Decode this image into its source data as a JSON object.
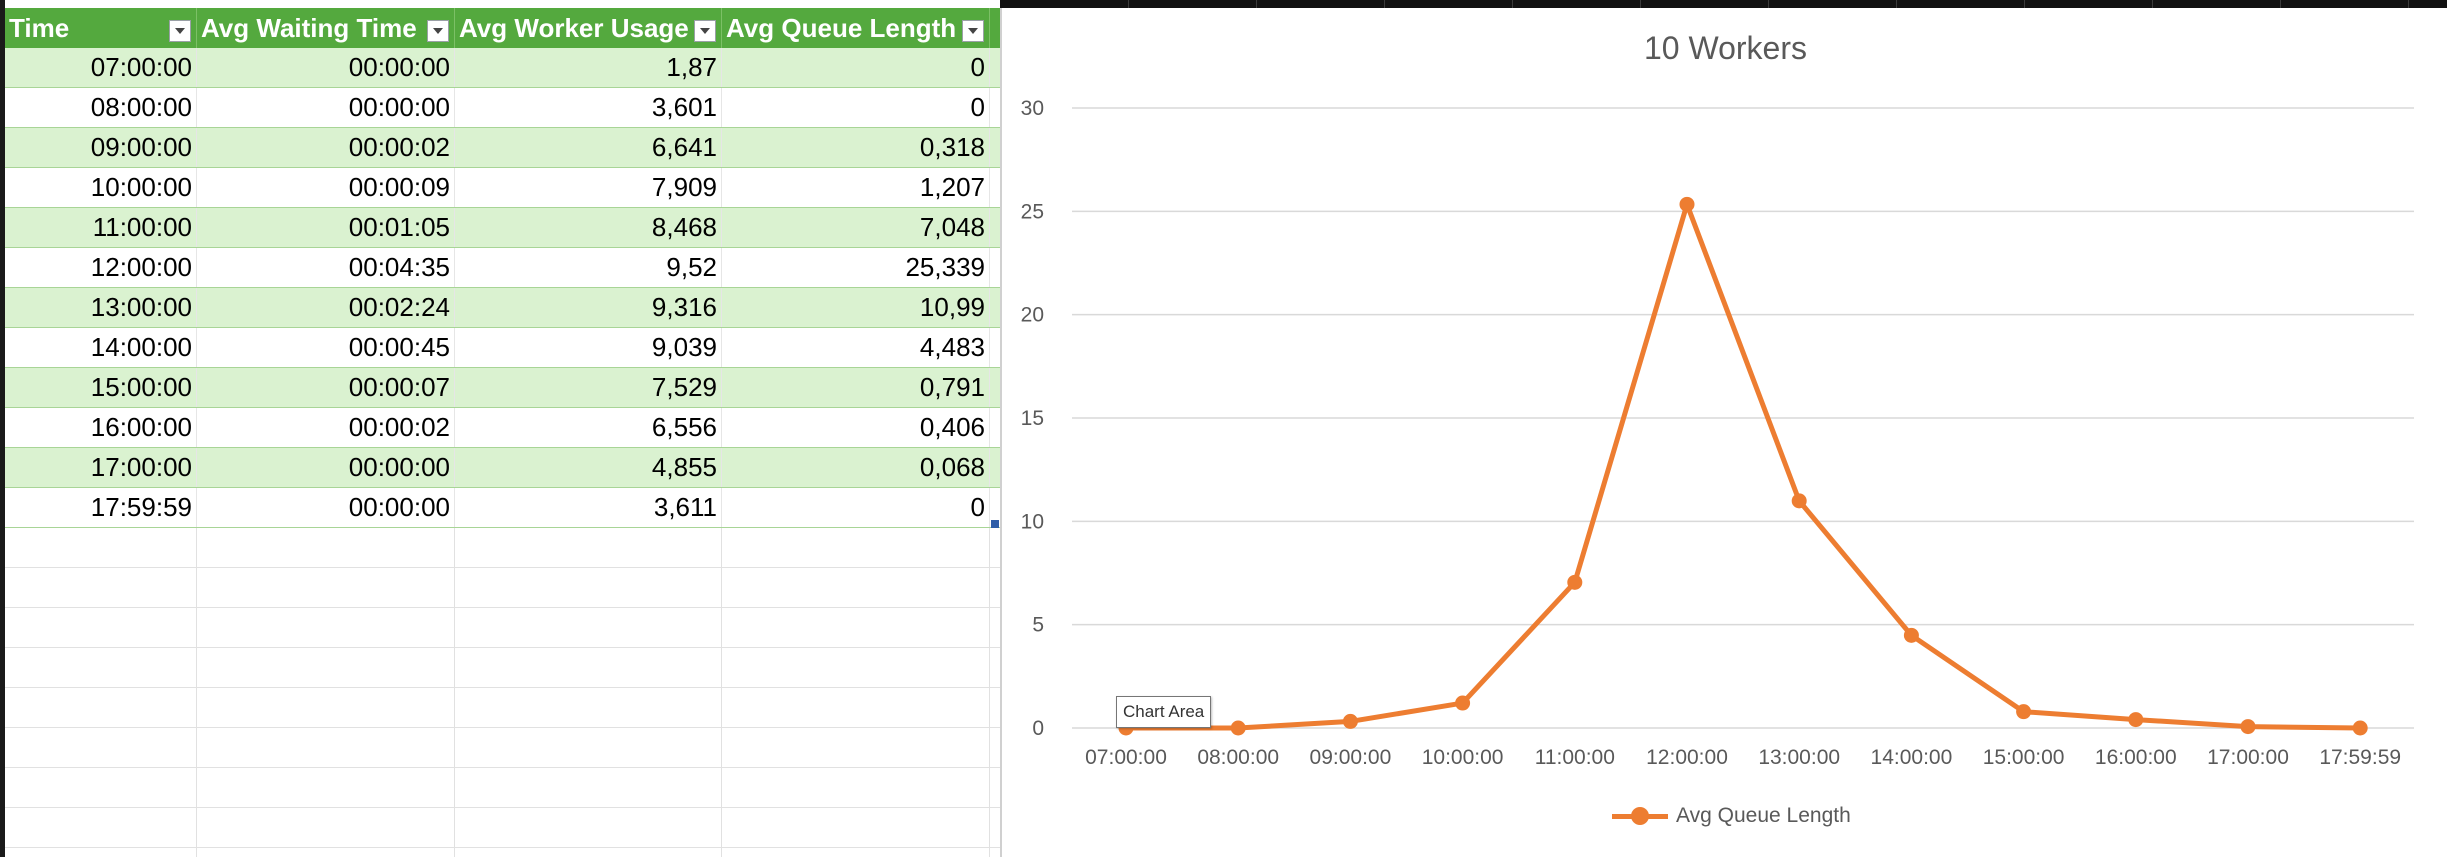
{
  "table": {
    "headers": [
      "Time",
      "Avg Waiting Time",
      "Avg Worker Usage",
      "Avg Queue Length"
    ],
    "rows": [
      [
        "07:00:00",
        "00:00:00",
        "1,87",
        "0"
      ],
      [
        "08:00:00",
        "00:00:00",
        "3,601",
        "0"
      ],
      [
        "09:00:00",
        "00:00:02",
        "6,641",
        "0,318"
      ],
      [
        "10:00:00",
        "00:00:09",
        "7,909",
        "1,207"
      ],
      [
        "11:00:00",
        "00:01:05",
        "8,468",
        "7,048"
      ],
      [
        "12:00:00",
        "00:04:35",
        "9,52",
        "25,339"
      ],
      [
        "13:00:00",
        "00:02:24",
        "9,316",
        "10,99"
      ],
      [
        "14:00:00",
        "00:00:45",
        "9,039",
        "4,483"
      ],
      [
        "15:00:00",
        "00:00:07",
        "7,529",
        "0,791"
      ],
      [
        "16:00:00",
        "00:00:02",
        "6,556",
        "0,406"
      ],
      [
        "17:00:00",
        "00:00:00",
        "4,855",
        "0,068"
      ],
      [
        "17:59:59",
        "00:00:00",
        "3,611",
        "0"
      ]
    ],
    "header_color": "#54a93e",
    "band_color": "#daf2d0"
  },
  "chart": {
    "tooltip": "Chart Area"
  },
  "chart_data": {
    "type": "line",
    "title": "10 Workers",
    "x": [
      "07:00:00",
      "08:00:00",
      "09:00:00",
      "10:00:00",
      "11:00:00",
      "12:00:00",
      "13:00:00",
      "14:00:00",
      "15:00:00",
      "16:00:00",
      "17:00:00",
      "17:59:59"
    ],
    "series": [
      {
        "name": "Avg Queue Length",
        "values": [
          0,
          0,
          0.318,
          1.207,
          7.048,
          25.339,
          10.99,
          4.483,
          0.791,
          0.406,
          0.068,
          0
        ],
        "color": "#ed7d31"
      }
    ],
    "ylim": [
      0,
      30
    ],
    "yticks": [
      0,
      5,
      10,
      15,
      20,
      25,
      30
    ],
    "grid": true,
    "legend": "bottom"
  }
}
